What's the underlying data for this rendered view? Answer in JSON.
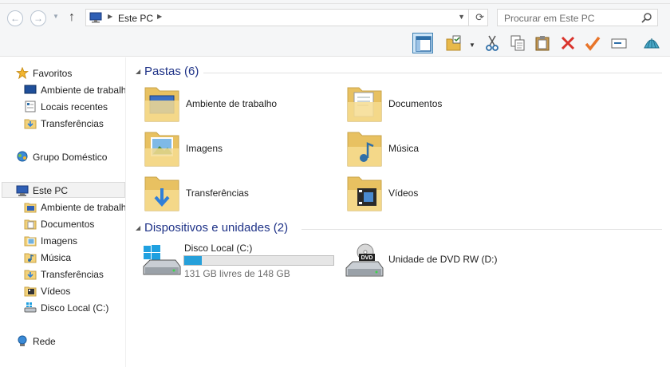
{
  "address": {
    "location": "Este PC"
  },
  "search": {
    "placeholder": "Procurar em Este PC"
  },
  "toolbar": {
    "icons": [
      "layout-pane-icon",
      "properties-icon",
      "cut-icon",
      "copy-icon",
      "paste-icon",
      "delete-icon",
      "apply-icon",
      "rename-icon",
      "shell-icon"
    ]
  },
  "sidebar": {
    "favorites": {
      "label": "Favoritos",
      "items": [
        "Ambiente de trabalho",
        "Locais recentes",
        "Transferências"
      ]
    },
    "homegroup": "Grupo Doméstico",
    "thispc": {
      "label": "Este PC",
      "items": [
        "Ambiente de trabalho",
        "Documentos",
        "Imagens",
        "Música",
        "Transferências",
        "Vídeos",
        "Disco Local (C:)"
      ]
    },
    "network": "Rede"
  },
  "folders": {
    "title": "Pastas (6)",
    "items": [
      "Ambiente de trabalho",
      "Documentos",
      "Imagens",
      "Música",
      "Transferências",
      "Vídeos"
    ]
  },
  "devices": {
    "title": "Dispositivos e unidades (2)",
    "disk": {
      "name": "Disco Local (C:)",
      "free_text": "131 GB livres de 148 GB",
      "used_fraction": 0.115
    },
    "dvd": {
      "name": "Unidade de DVD RW (D:)"
    }
  },
  "colors": {
    "accent": "#26a0da",
    "group_title": "#1e3287",
    "folder": "#f3d27a"
  }
}
